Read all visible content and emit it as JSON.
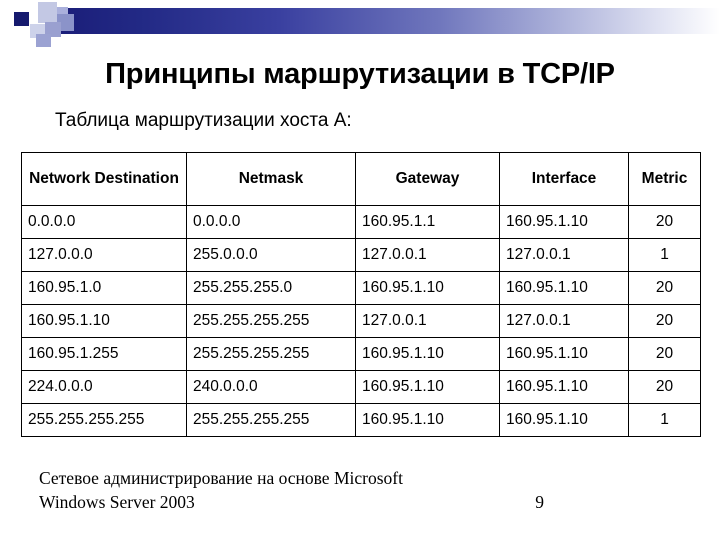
{
  "slide": {
    "title": "Принципы маршрутизации в TCP/IP",
    "subtitle": "Таблица маршрутизации хоста А:"
  },
  "decoration": {
    "bar_gradient_from": "#1a1d78",
    "bar_gradient_to": "#ffffff",
    "square_dark": "#161a6e",
    "square_mid": "#9aa0d0",
    "square_pale": "#c3c8e4"
  },
  "table": {
    "headers": [
      "Network Destination",
      "Netmask",
      "Gateway",
      "Interface",
      "Metric"
    ],
    "rows": [
      {
        "destination": "0.0.0.0",
        "netmask": "0.0.0.0",
        "gateway": "160.95.1.1",
        "interface": "160.95.1.10",
        "metric": "20"
      },
      {
        "destination": "127.0.0.0",
        "netmask": "255.0.0.0",
        "gateway": "127.0.0.1",
        "interface": "127.0.0.1",
        "metric": "1"
      },
      {
        "destination": "160.95.1.0",
        "netmask": "255.255.255.0",
        "gateway": "160.95.1.10",
        "interface": "160.95.1.10",
        "metric": "20"
      },
      {
        "destination": "160.95.1.10",
        "netmask": "255.255.255.255",
        "gateway": "127.0.0.1",
        "interface": "127.0.0.1",
        "metric": "20"
      },
      {
        "destination": "160.95.1.255",
        "netmask": "255.255.255.255",
        "gateway": "160.95.1.10",
        "interface": "160.95.1.10",
        "metric": "20"
      },
      {
        "destination": "224.0.0.0",
        "netmask": "240.0.0.0",
        "gateway": "160.95.1.10",
        "interface": "160.95.1.10",
        "metric": "20"
      },
      {
        "destination": "255.255.255.255",
        "netmask": "255.255.255.255",
        "gateway": "160.95.1.10",
        "interface": "160.95.1.10",
        "metric": "1"
      }
    ]
  },
  "footer": {
    "line1": "Сетевое администрирование на основе Microsoft",
    "line2": "Windows Server 2003",
    "page_number": "9"
  }
}
